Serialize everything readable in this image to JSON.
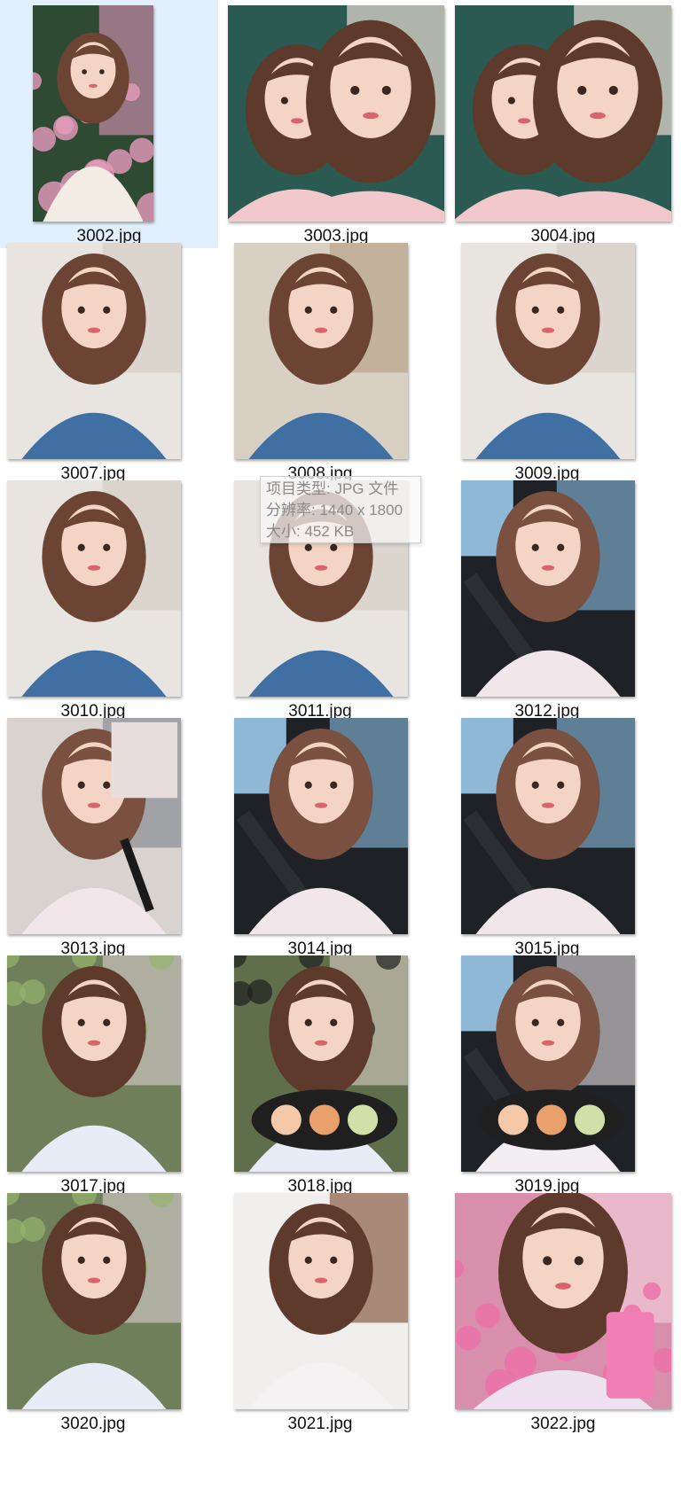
{
  "files": [
    {
      "name": "3002.jpg",
      "scene": "garden",
      "selected": true
    },
    {
      "name": "3003.jpg",
      "scene": "duo"
    },
    {
      "name": "3004.jpg",
      "scene": "duo"
    },
    {
      "name": "3007.jpg",
      "scene": "denim"
    },
    {
      "name": "3008.jpg",
      "scene": "denim-cafe"
    },
    {
      "name": "3009.jpg",
      "scene": "denim"
    },
    {
      "name": "3010.jpg",
      "scene": "denim"
    },
    {
      "name": "3011.jpg",
      "scene": "denim"
    },
    {
      "name": "3012.jpg",
      "scene": "car"
    },
    {
      "name": "3013.jpg",
      "scene": "cosmetics"
    },
    {
      "name": "3014.jpg",
      "scene": "car"
    },
    {
      "name": "3015.jpg",
      "scene": "car"
    },
    {
      "name": "3017.jpg",
      "scene": "outdoor"
    },
    {
      "name": "3018.jpg",
      "scene": "palette-ad"
    },
    {
      "name": "3019.jpg",
      "scene": "car-palette"
    },
    {
      "name": "3020.jpg",
      "scene": "outdoor"
    },
    {
      "name": "3021.jpg",
      "scene": "indoor"
    },
    {
      "name": "3022.jpg",
      "scene": "blossom"
    }
  ],
  "tooltip": {
    "type_line": "项目类型: JPG 文件",
    "resolution_line": "分辨率: 1440 x 1800",
    "size_line": "大小: 452 KB"
  },
  "colors": {
    "selection_bg": "#e1f0fc",
    "denim": "#3f6fa3",
    "hair": "#6b4434",
    "skin": "#f4d4c4"
  }
}
